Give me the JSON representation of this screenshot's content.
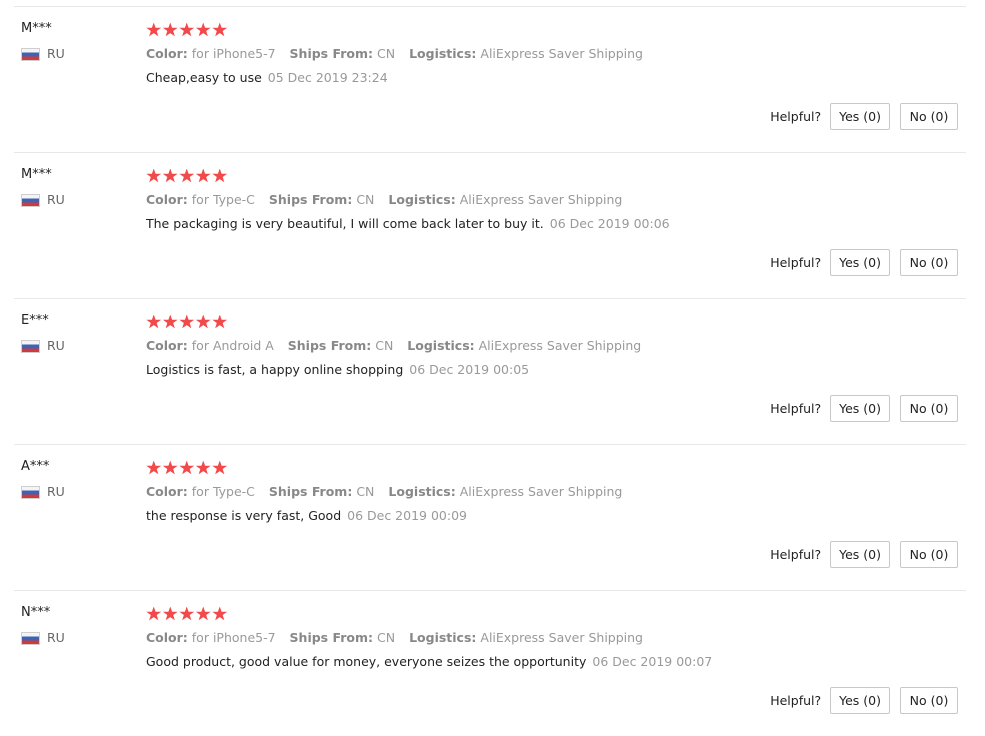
{
  "helpful_label": "Helpful?",
  "star_color": "#f24a4a",
  "reviews": [
    {
      "user": "M***",
      "country": "RU",
      "rating": 5,
      "color_label": "Color:",
      "color_value": "for iPhone5-7",
      "ships_label": "Ships From:",
      "ships_value": "CN",
      "logistics_label": "Logistics:",
      "logistics_value": "AliExpress Saver Shipping",
      "text": "Cheap,easy to use",
      "date": "05 Dec 2019 23:24",
      "yes": "Yes (0)",
      "no": "No (0)"
    },
    {
      "user": "M***",
      "country": "RU",
      "rating": 5,
      "color_label": "Color:",
      "color_value": "for Type-C",
      "ships_label": "Ships From:",
      "ships_value": "CN",
      "logistics_label": "Logistics:",
      "logistics_value": "AliExpress Saver Shipping",
      "text": "The packaging is very beautiful, I will come back later to buy it.",
      "date": "06 Dec 2019 00:06",
      "yes": "Yes (0)",
      "no": "No (0)"
    },
    {
      "user": "E***",
      "country": "RU",
      "rating": 5,
      "color_label": "Color:",
      "color_value": "for Android A",
      "ships_label": "Ships From:",
      "ships_value": "CN",
      "logistics_label": "Logistics:",
      "logistics_value": "AliExpress Saver Shipping",
      "text": "Logistics is fast, a happy online shopping",
      "date": "06 Dec 2019 00:05",
      "yes": "Yes (0)",
      "no": "No (0)"
    },
    {
      "user": "A***",
      "country": "RU",
      "rating": 5,
      "color_label": "Color:",
      "color_value": "for Type-C",
      "ships_label": "Ships From:",
      "ships_value": "CN",
      "logistics_label": "Logistics:",
      "logistics_value": "AliExpress Saver Shipping",
      "text": "the response is very fast, Good",
      "date": "06 Dec 2019 00:09",
      "yes": "Yes (0)",
      "no": "No (0)"
    },
    {
      "user": "N***",
      "country": "RU",
      "rating": 5,
      "color_label": "Color:",
      "color_value": "for iPhone5-7",
      "ships_label": "Ships From:",
      "ships_value": "CN",
      "logistics_label": "Logistics:",
      "logistics_value": "AliExpress Saver Shipping",
      "text": "Good product, good value for money, everyone seizes the opportunity",
      "date": "06 Dec 2019 00:07",
      "yes": "Yes (0)",
      "no": "No (0)"
    }
  ]
}
